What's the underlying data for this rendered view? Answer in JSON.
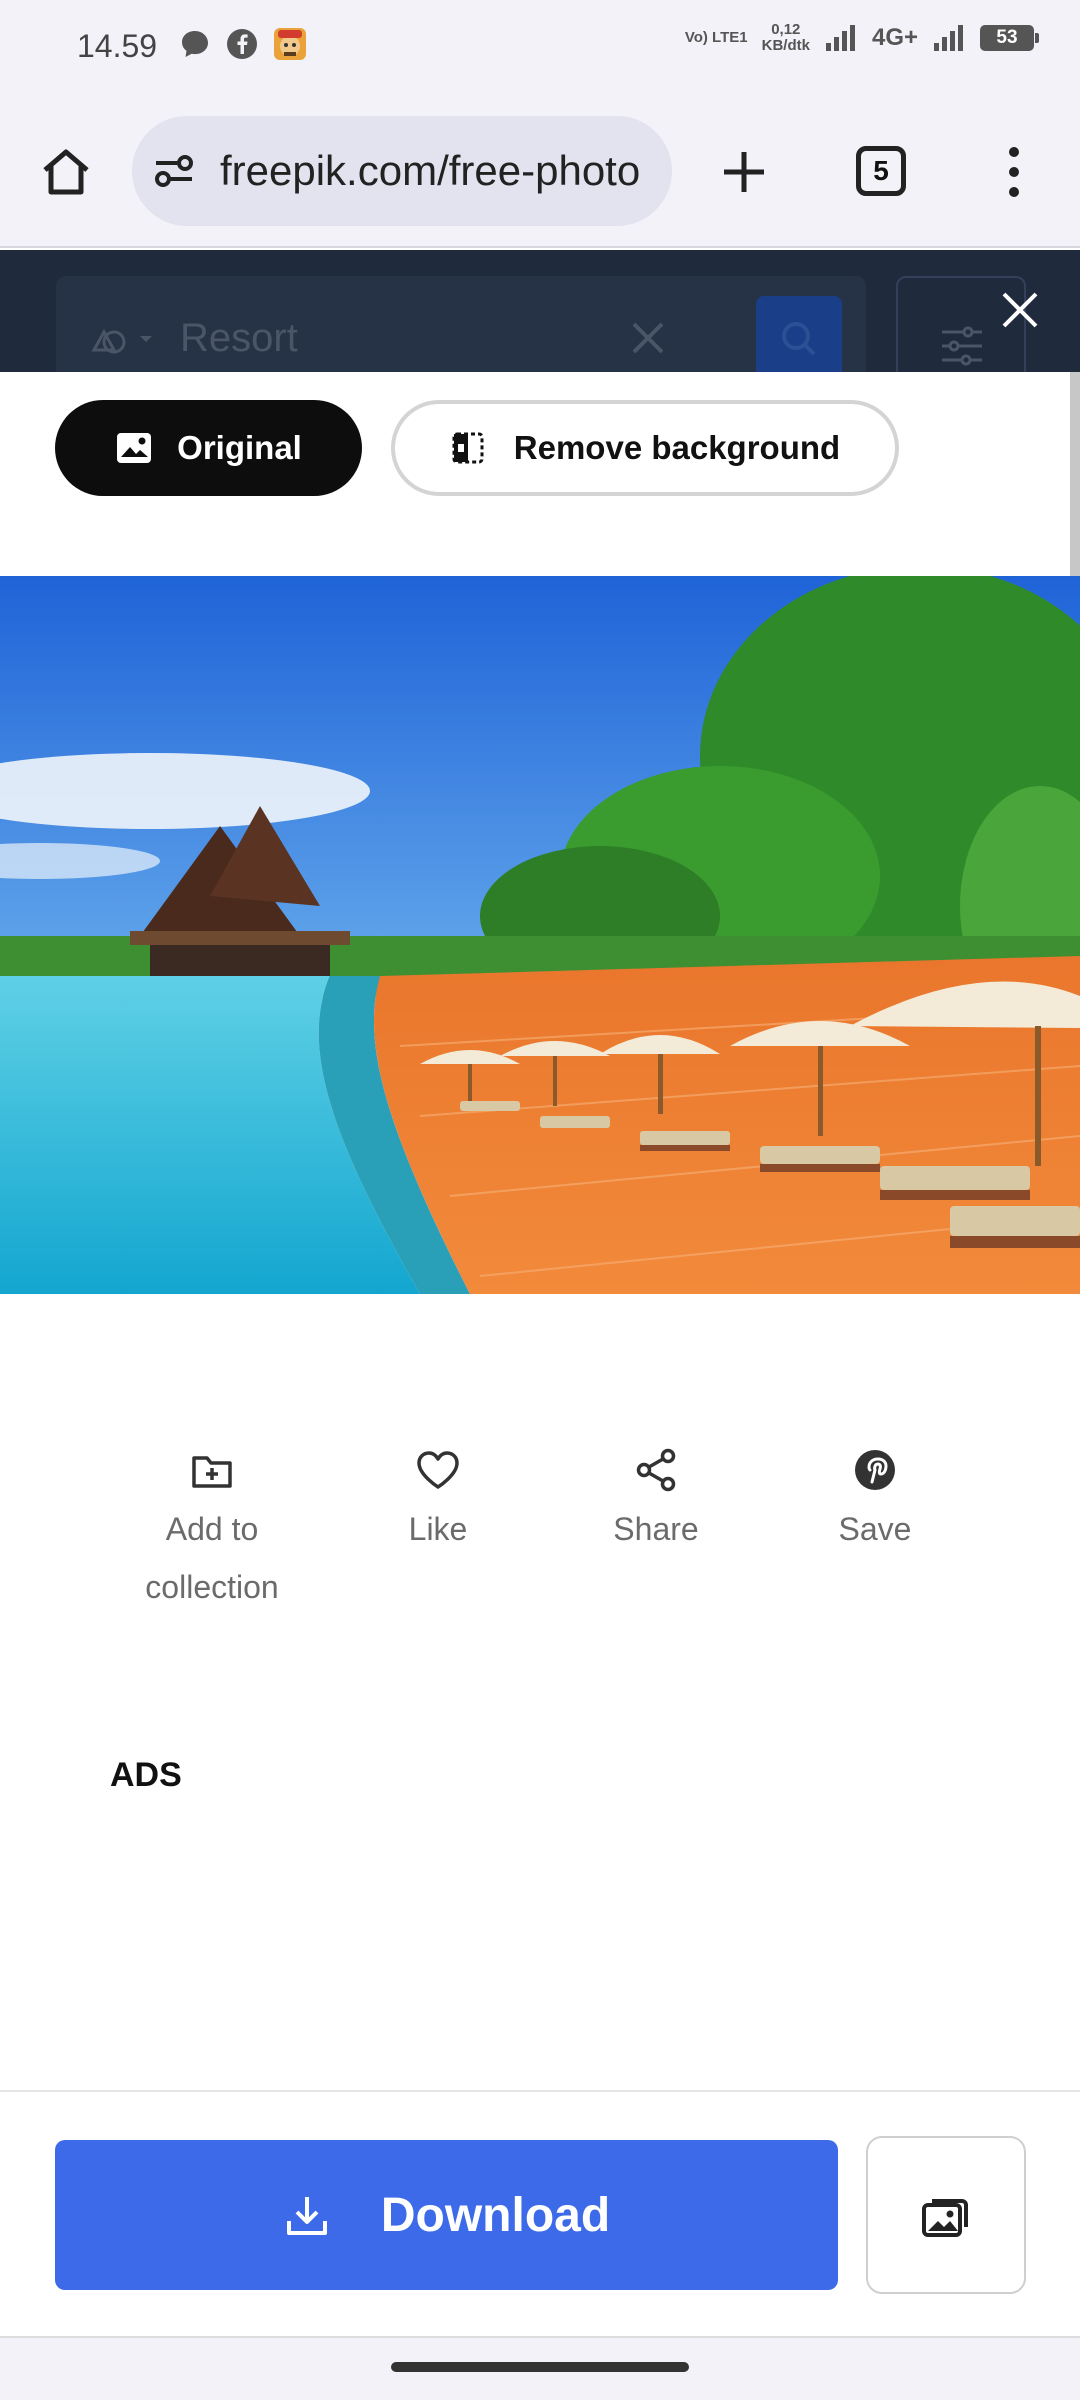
{
  "status_bar": {
    "time": "14.59",
    "volte": "Vo) LTE1",
    "net_speed_value": "0,12",
    "net_speed_unit": "KB/dtk",
    "network": "4G+",
    "battery": "53",
    "icons": [
      "chat-bubble-icon",
      "facebook-icon",
      "game-avatar-icon",
      "signal-icon",
      "signal-icon",
      "battery-icon"
    ]
  },
  "browser": {
    "url": "freepik.com/free-photo",
    "tab_count": "5",
    "icons": [
      "home-icon",
      "site-info-icon",
      "new-tab-plus-icon",
      "tab-switcher-icon",
      "more-menu-icon"
    ]
  },
  "search": {
    "placeholder": "Resort"
  },
  "view_toggle": {
    "original_label": "Original",
    "remove_bg_label": "Remove background"
  },
  "actions": {
    "add_to_collection": "Add to collection",
    "like": "Like",
    "share": "Share",
    "save": "Save"
  },
  "ads_label": "ADS",
  "download": {
    "label": "Download"
  },
  "colors": {
    "accent_blue": "#3d6ae8",
    "header_dark": "#1f2a3d",
    "toolbar_bg": "#f3f2f8"
  }
}
